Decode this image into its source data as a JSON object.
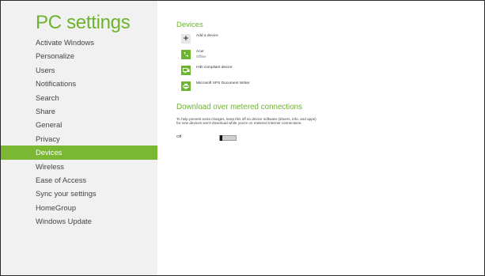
{
  "sidebar": {
    "title": "PC settings",
    "items": [
      {
        "label": "Activate Windows",
        "name": "sidebar-item-activate-windows",
        "active": false
      },
      {
        "label": "Personalize",
        "name": "sidebar-item-personalize",
        "active": false
      },
      {
        "label": "Users",
        "name": "sidebar-item-users",
        "active": false
      },
      {
        "label": "Notifications",
        "name": "sidebar-item-notifications",
        "active": false
      },
      {
        "label": "Search",
        "name": "sidebar-item-search",
        "active": false
      },
      {
        "label": "Share",
        "name": "sidebar-item-share",
        "active": false
      },
      {
        "label": "General",
        "name": "sidebar-item-general",
        "active": false
      },
      {
        "label": "Privacy",
        "name": "sidebar-item-privacy",
        "active": false
      },
      {
        "label": "Devices",
        "name": "sidebar-item-devices",
        "active": true
      },
      {
        "label": "Wireless",
        "name": "sidebar-item-wireless",
        "active": false
      },
      {
        "label": "Ease of Access",
        "name": "sidebar-item-ease-of-access",
        "active": false
      },
      {
        "label": "Sync your settings",
        "name": "sidebar-item-sync-your-settings",
        "active": false
      },
      {
        "label": "HomeGroup",
        "name": "sidebar-item-homegroup",
        "active": false
      },
      {
        "label": "Windows Update",
        "name": "sidebar-item-windows-update",
        "active": false
      }
    ]
  },
  "devices": {
    "title": "Devices",
    "items": [
      {
        "name": "Add a device",
        "status": "",
        "icon": "plus-icon"
      },
      {
        "name": "Acer",
        "status": "Offline",
        "icon": "phone-icon"
      },
      {
        "name": "HID-compliant device",
        "status": "",
        "icon": "keyboard-icon"
      },
      {
        "name": "Microsoft XPS Document Writer",
        "status": "",
        "icon": "printer-icon"
      }
    ]
  },
  "metered": {
    "title": "Download over metered connections",
    "description": "To help prevent extra charges, keep this off so device software (drivers, info, and apps) for new devices won't download while you're on metered Internet connections.",
    "toggle_label": "Off",
    "toggle_on": false
  },
  "colors": {
    "accent": "#6cb32f",
    "active_bg": "#7ab732",
    "sidebar_bg": "#f1f1f1"
  }
}
